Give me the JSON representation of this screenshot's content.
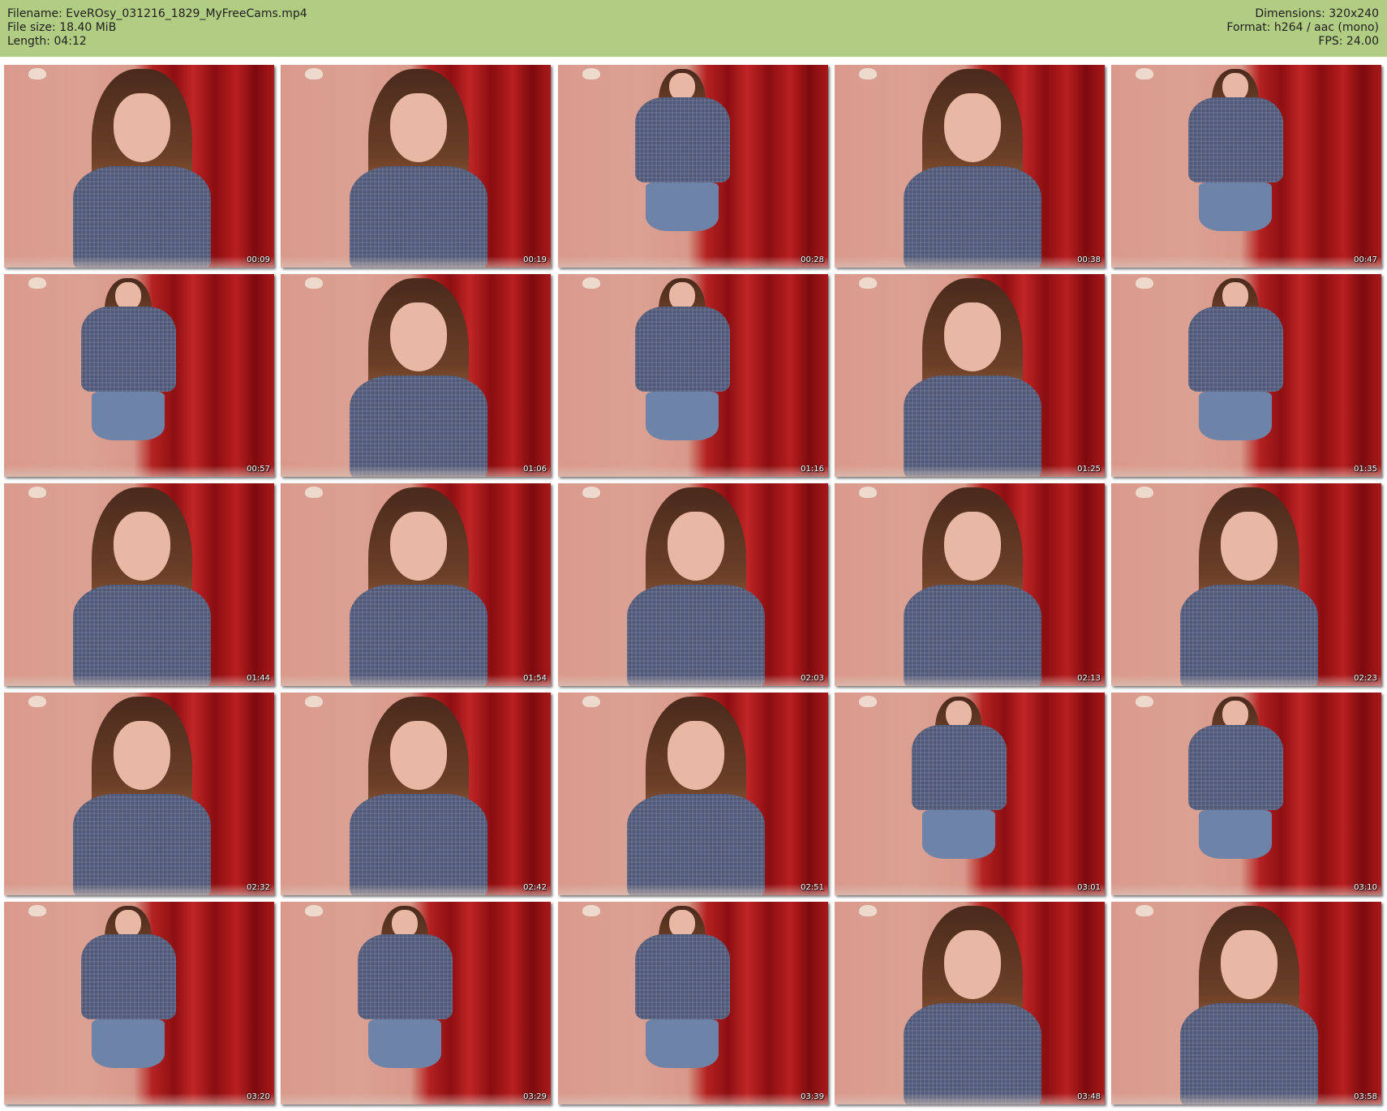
{
  "header": {
    "filename": "Filename: EveROsy_031216_1829_MyFreeCams.mp4",
    "file_size": "File size: 18.40 MiB",
    "length": "Length: 04:12",
    "dimensions": "Dimensions: 320x240",
    "format": "Format: h264 / aac (mono)",
    "fps": "FPS: 24.00"
  },
  "thumbnails": [
    {
      "time": "00:09",
      "shot": "close"
    },
    {
      "time": "00:19",
      "shot": "close"
    },
    {
      "time": "00:28",
      "shot": "standing"
    },
    {
      "time": "00:38",
      "shot": "close"
    },
    {
      "time": "00:47",
      "shot": "standing"
    },
    {
      "time": "00:57",
      "shot": "standing"
    },
    {
      "time": "01:06",
      "shot": "close"
    },
    {
      "time": "01:16",
      "shot": "standing"
    },
    {
      "time": "01:25",
      "shot": "close"
    },
    {
      "time": "01:35",
      "shot": "standing"
    },
    {
      "time": "01:44",
      "shot": "close"
    },
    {
      "time": "01:54",
      "shot": "close"
    },
    {
      "time": "02:03",
      "shot": "close"
    },
    {
      "time": "02:13",
      "shot": "close"
    },
    {
      "time": "02:23",
      "shot": "close"
    },
    {
      "time": "02:32",
      "shot": "close"
    },
    {
      "time": "02:42",
      "shot": "close"
    },
    {
      "time": "02:51",
      "shot": "close"
    },
    {
      "time": "03:01",
      "shot": "standing"
    },
    {
      "time": "03:10",
      "shot": "standing"
    },
    {
      "time": "03:20",
      "shot": "standing"
    },
    {
      "time": "03:29",
      "shot": "standing"
    },
    {
      "time": "03:39",
      "shot": "standing"
    },
    {
      "time": "03:48",
      "shot": "close"
    },
    {
      "time": "03:58",
      "shot": "close"
    }
  ]
}
